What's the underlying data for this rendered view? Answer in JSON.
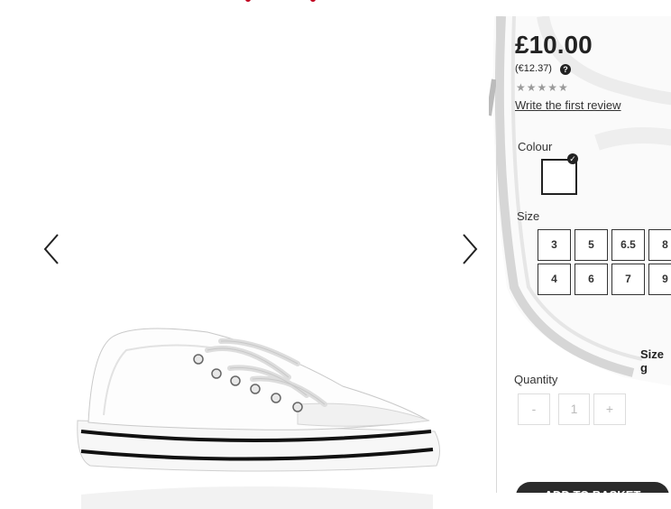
{
  "product": {
    "price": "£10.00",
    "price_alt": "(€12.37)",
    "help_icon_text": "?",
    "rating_stars": "★★★★★",
    "review_link": "Write the first review"
  },
  "colour": {
    "label": "Colour",
    "selected_swatch": "white",
    "check_glyph": "✓"
  },
  "size": {
    "label": "Size",
    "options_row1": [
      "3",
      "5",
      "6.5",
      "8"
    ],
    "options_row2": [
      "4",
      "6",
      "7",
      "9"
    ],
    "guide_label": "Size g"
  },
  "quantity": {
    "label": "Quantity",
    "minus": "-",
    "value": "1",
    "plus": "+"
  },
  "basket": {
    "label": "ADD TO BASKET"
  },
  "icons": {
    "prev": "chevron-left-icon",
    "next": "chevron-right-icon"
  },
  "colors": {
    "text": "#333333",
    "button_dark": "#2b2b2b",
    "accent_red": "#c0001d",
    "border_light": "#dddddd"
  }
}
